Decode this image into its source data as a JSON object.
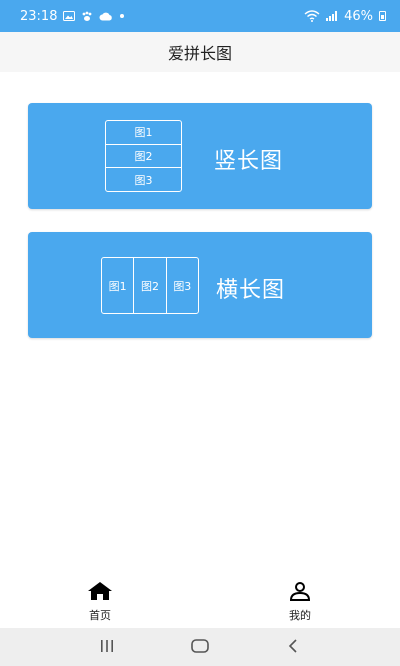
{
  "status_bar": {
    "time": "23:18",
    "battery": "46%"
  },
  "header": {
    "title": "爱拼长图"
  },
  "cards": {
    "vertical": {
      "label": "竖长图",
      "cells": [
        "图1",
        "图2",
        "图3"
      ]
    },
    "horizontal": {
      "label": "横长图",
      "cells": [
        "图1",
        "图2",
        "图3"
      ]
    }
  },
  "bottom_nav": {
    "home_label": "首页",
    "mine_label": "我的"
  },
  "colors": {
    "accent": "#4aa8ee",
    "header_bg": "#f6f6f6",
    "nav_bar_bg": "#eeeeee"
  },
  "icons": {
    "home": "home-icon",
    "profile": "person-icon",
    "recents": "recents-icon",
    "home_sys": "home-button-icon",
    "back": "back-icon"
  }
}
